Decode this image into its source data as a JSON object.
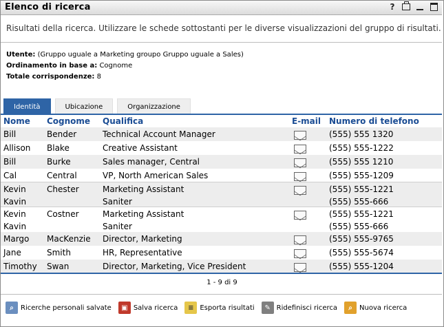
{
  "window": {
    "title": "Elenco di ricerca"
  },
  "intro": "Risultati della ricerca. Utilizzare le schede sottostanti per le diverse visualizzazioni del gruppo di risultati.",
  "meta": {
    "user_label": "Utente:",
    "user_value": "(Gruppo uguale a Marketing groupo Gruppo uguale a Sales)",
    "order_label": "Ordinamento in base a:",
    "order_value": "Cognome",
    "total_label": "Totale corrispondenze:",
    "total_value": "8"
  },
  "tabs": [
    {
      "label": "Identità"
    },
    {
      "label": "Ubicazione"
    },
    {
      "label": "Organizzazione"
    }
  ],
  "table": {
    "headers": {
      "nome": "Nome",
      "cognome": "Cognome",
      "qualifica": "Qualifica",
      "email": "E-mail",
      "telefono": "Numero di telefono"
    },
    "rows": [
      {
        "nome": "Bill",
        "cognome": "Bender",
        "qualifica": "Technical Account Manager",
        "telefono": "(555) 555 1320"
      },
      {
        "nome": "Allison",
        "cognome": "Blake",
        "qualifica": "Creative Assistant",
        "telefono": "(555) 555-1222"
      },
      {
        "nome": "Bill",
        "cognome": "Burke",
        "qualifica": "Sales manager, Central",
        "telefono": "(555) 555 1210"
      },
      {
        "nome": "Cal",
        "cognome": "Central",
        "qualifica": "VP, North American Sales",
        "telefono": "(555) 555-1209"
      },
      {
        "nome": "Kevin",
        "cognome": "Chester",
        "qualifica": "Marketing Assistant",
        "telefono": "(555) 555-1221"
      },
      {
        "nome": "Kavin",
        "cognome": "",
        "qualifica": "Saniter",
        "telefono": "(555) 555-666"
      },
      {
        "nome": "Kevin",
        "cognome": "Costner",
        "qualifica": "Marketing Assistant",
        "telefono": "(555) 555-1221"
      },
      {
        "nome": "Kavin",
        "cognome": "",
        "qualifica": "Saniter",
        "telefono": "(555) 555-666"
      },
      {
        "nome": "Margo",
        "cognome": "MacKenzie",
        "qualifica": "Director, Marketing",
        "telefono": "(555) 555-9765"
      },
      {
        "nome": "Jane",
        "cognome": "Smith",
        "qualifica": "HR, Representative",
        "telefono": "(555) 555-5674"
      },
      {
        "nome": "Timothy",
        "cognome": "Swan",
        "qualifica": "Director, Marketing, Vice President",
        "telefono": "(555) 555-1204"
      }
    ]
  },
  "pager": "1 - 9 di 9",
  "actions": {
    "saved": "Ricerche personali salvate",
    "save": "Salva ricerca",
    "export": "Esporta risultati",
    "refine": "Ridefinisci ricerca",
    "new": "Nuova ricerca"
  }
}
